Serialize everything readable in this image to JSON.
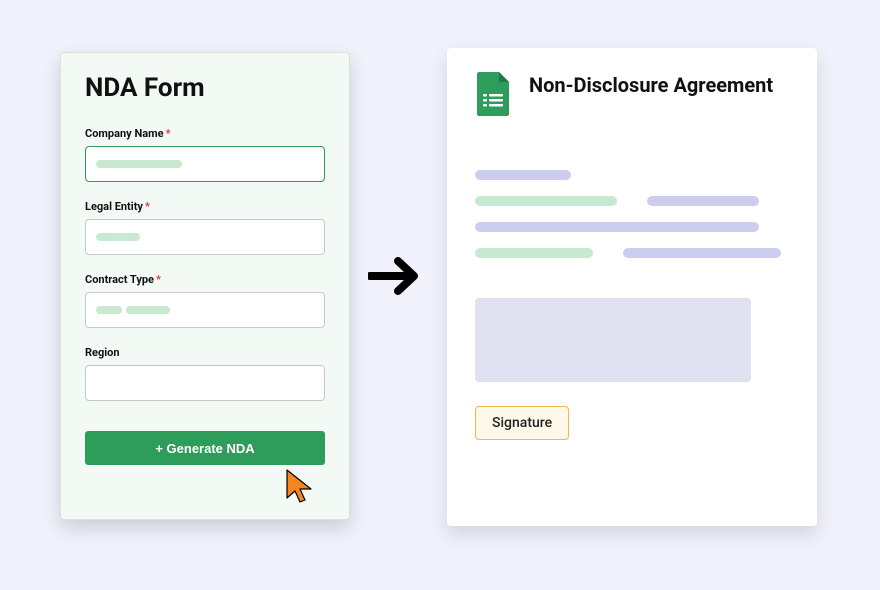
{
  "form": {
    "title": "NDA Form",
    "fields": {
      "company": {
        "label": "Company Name",
        "required": "*"
      },
      "entity": {
        "label": "Legal Entity",
        "required": "*"
      },
      "contract": {
        "label": "Contract Type",
        "required": "*"
      },
      "region": {
        "label": "Region",
        "required": ""
      }
    },
    "button_label": "+ Generate NDA"
  },
  "document": {
    "title": "Non-Disclosure Agreement",
    "signature_label": "Signature"
  },
  "colors": {
    "accent_green": "#2E9C5B",
    "accent_orange": "#F3B74F",
    "placeholder_green": "#C7E9CF",
    "placeholder_purple": "#CDCEEF"
  }
}
